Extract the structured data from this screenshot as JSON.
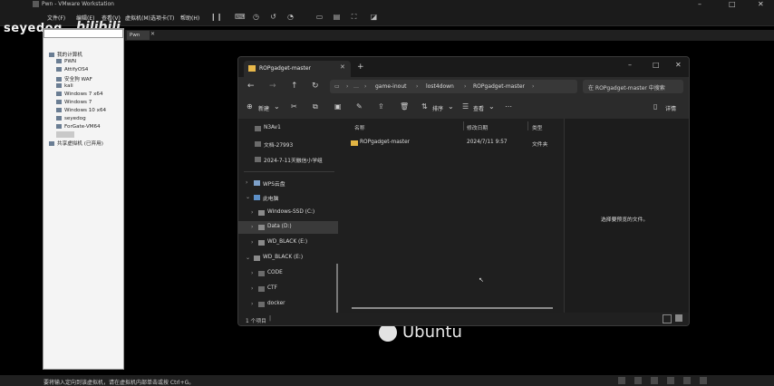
{
  "vmware": {
    "title": "Pwn - VMware Workstation",
    "menu": [
      "文件(F)",
      "编辑(E)",
      "查看(V)",
      "虚拟机(M)",
      "选项卡(T)",
      "帮助(H)"
    ],
    "watermark": "seyedog",
    "watermark_brand": "bilibili",
    "tab_label": "Pwn",
    "library_items": [
      "我的计算机",
      "PWN",
      "AttifyOS4",
      "安全狗 WAF",
      "kali",
      "Windows 7 x64",
      "Windows 7",
      "Windows 10 x64",
      "seyedog",
      "ForGate-VM64",
      "",
      "共享虚拟机 (已弃用)"
    ],
    "status_text": "要将输入定向到该虚拟机，请在虚拟机内部单击或按 Ctrl+G。",
    "ubuntu_label": "Ubuntu"
  },
  "explorer": {
    "tab_title": "ROPgadget-master",
    "breadcrumbs": [
      "game-inout",
      "lost4down",
      "ROPgadget-master"
    ],
    "search_placeholder": "在 ROPgadget-master 中搜索",
    "commands": {
      "new": "新建",
      "sort": "排序",
      "view": "查看",
      "details": "详情"
    },
    "nav_items": [
      {
        "label": "N3Av1",
        "chevron": ""
      },
      {
        "label": "文档-27993",
        "chevron": ""
      },
      {
        "label": "2024-7-11天融信小学组",
        "chevron": ""
      },
      {
        "label": "WPS云盘",
        "chevron": "›"
      },
      {
        "label": "此电脑",
        "chevron": "⌄"
      },
      {
        "label": "Windows-SSD (C:)",
        "chevron": "›"
      },
      {
        "label": "Data (D:)",
        "chevron": "›"
      },
      {
        "label": "WD_BLACK (E:)",
        "chevron": "›"
      },
      {
        "label": "WD_BLACK (E:)",
        "chevron": "⌄"
      },
      {
        "label": "CODE",
        "chevron": "›"
      },
      {
        "label": "CTF",
        "chevron": "›"
      },
      {
        "label": "docker",
        "chevron": "›"
      }
    ],
    "columns": {
      "name": "名称",
      "modified": "修改日期",
      "type": "类型"
    },
    "rows": [
      {
        "name": "ROPgadget-master",
        "modified": "2024/7/11 9:57",
        "type": "文件夹"
      }
    ],
    "preview_text": "选择要预览的文件。",
    "status_count": "1 个项目"
  }
}
